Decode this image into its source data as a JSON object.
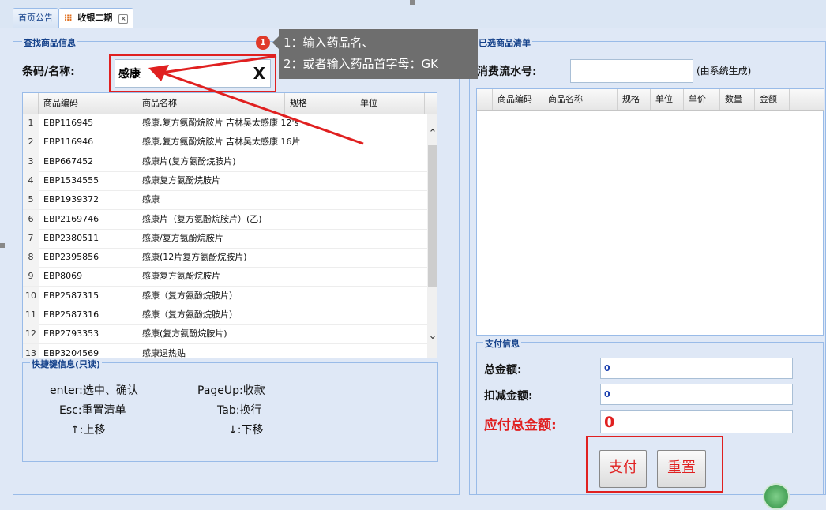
{
  "tabs": [
    {
      "label": "首页公告"
    },
    {
      "label": "收银二期",
      "close": "×"
    }
  ],
  "left": {
    "search_legend": "查找商品信息",
    "barcode_label": "条码/名称:",
    "search_value": "感康",
    "clear_symbol": "X",
    "grid_headers": [
      "商品编码",
      "商品名称",
      "规格",
      "单位"
    ],
    "rows": [
      {
        "n": "1",
        "code": "EBP116945",
        "name": "感康,复方氨酚烷胺片 吉林吴太感康 12's"
      },
      {
        "n": "2",
        "code": "EBP116946",
        "name": "感康,复方氨酚烷胺片 吉林吴太感康 16片"
      },
      {
        "n": "3",
        "code": "EBP667452",
        "name": "感康片(复方氨酚烷胺片)"
      },
      {
        "n": "4",
        "code": "EBP1534555",
        "name": "感康复方氨酚烷胺片"
      },
      {
        "n": "5",
        "code": "EBP1939372",
        "name": "感康"
      },
      {
        "n": "6",
        "code": "EBP2169746",
        "name": "感康片（复方氨酚烷胺片）(乙)"
      },
      {
        "n": "7",
        "code": "EBP2380511",
        "name": "感康/复方氨酚烷胺片"
      },
      {
        "n": "8",
        "code": "EBP2395856",
        "name": "感康(12片复方氨酚烷胺片)"
      },
      {
        "n": "9",
        "code": "EBP8069",
        "name": "感康复方氨酚烷胺片"
      },
      {
        "n": "10",
        "code": "EBP2587315",
        "name": "感康（复方氨酚烷胺片）"
      },
      {
        "n": "11",
        "code": "EBP2587316",
        "name": "感康（复方氨酚烷胺片）"
      },
      {
        "n": "12",
        "code": "EBP2793353",
        "name": "感康(复方氨酚烷胺片)"
      },
      {
        "n": "13",
        "code": "EBP3204569",
        "name": "感康退热贴"
      }
    ],
    "hotkey_legend": "快捷键信息(只读)",
    "hotkeys": {
      "enter": "enter:选中、确认",
      "pageup": "PageUp:收款",
      "esc": "Esc:重置清单",
      "tab": "Tab:换行",
      "up": "↑:上移",
      "down": "↓:下移"
    }
  },
  "right": {
    "list_legend": "已选商品清单",
    "serial_label": "消费流水号:",
    "serial_value": "",
    "serial_note": "(由系统生成)",
    "grid_headers": [
      "商品编码",
      "商品名称",
      "规格",
      "单位",
      "单价",
      "数量",
      "金额"
    ],
    "pay_legend": "支付信息",
    "total_label": "总金额:",
    "total_value": "0",
    "discount_label": "扣减金额:",
    "discount_value": "0",
    "payable_label": "应付总金额:",
    "payable_value": "0",
    "pay_button": "支付",
    "reset_button": "重置"
  },
  "tooltip": {
    "badge": "1",
    "line1": "1：输入药品名、",
    "line2": "2：或者输入药品首字母：GK"
  },
  "colors": {
    "accent_red": "#e02020",
    "panel_bg": "#dfe8f6",
    "border_blue": "#99bbe8",
    "value_blue": "#1a3fae"
  }
}
